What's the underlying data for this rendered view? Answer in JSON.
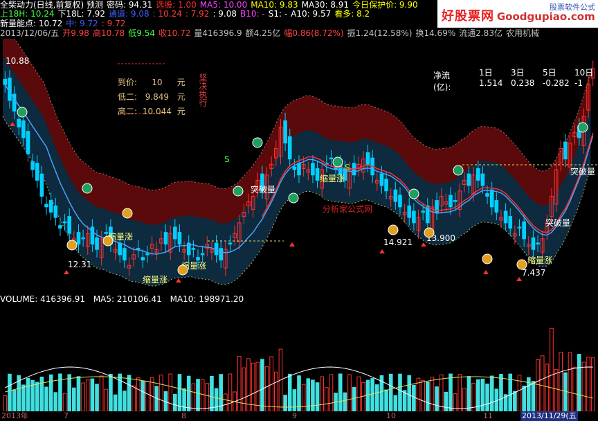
{
  "header": {
    "row1": [
      {
        "text": "全柴动力(日线,前复权) 预测",
        "color": "#ffffff"
      },
      {
        "text": "密码: 94.31",
        "color": "#ffffff"
      },
      {
        "text": "选股: 1.00",
        "color": "#ff3030"
      },
      {
        "text": "MA5: 10.00",
        "color": "#ff40ff"
      },
      {
        "text": "MA10: 9.83",
        "color": "#ffff00"
      },
      {
        "text": "MA30: 8.91",
        "color": "#ffffff"
      },
      {
        "text": "今日保护价: 9.90",
        "color": "#ffff00"
      }
    ],
    "row2": [
      {
        "text": "上18H: 10.24",
        "color": "#40ff40"
      },
      {
        "text": "下18L: 7.92",
        "color": "#ffffff"
      },
      {
        "text": "通道: 9.08",
        "color": "#4060ff"
      },
      {
        "text": ": 10.24",
        "color": "#ff4040"
      },
      {
        "text": ": 7.92",
        "color": "#ff4040"
      },
      {
        "text": ": 9.08",
        "color": "#ffffff"
      },
      {
        "text": "B10: -",
        "color": "#ff40ff"
      },
      {
        "text": "S1: -",
        "color": "#ffffff"
      },
      {
        "text": "A10: 9.57",
        "color": "#ffffff"
      },
      {
        "text": "看多: 8.2",
        "color": "#ffff00"
      }
    ],
    "row3": [
      {
        "text": "新量能点: 10.72",
        "color": "#ffffff"
      },
      {
        "text": "中: 9.72",
        "color": "#4060ff"
      },
      {
        "text": ": 9.72",
        "color": "#ff4040"
      }
    ],
    "row4": [
      {
        "text": "2013/12/06/五",
        "color": "#c0c0c0"
      },
      {
        "text": "开9.98",
        "color": "#ff4040"
      },
      {
        "text": "高10.78",
        "color": "#ff4040"
      },
      {
        "text": "低9.54",
        "color": "#40ff40"
      },
      {
        "text": "收10.72",
        "color": "#ff4040"
      },
      {
        "text": "量416396.9",
        "color": "#c0c0c0"
      },
      {
        "text": "额4.25亿",
        "color": "#c0c0c0"
      },
      {
        "text": "幅0.86(8.72%)",
        "color": "#ff4040"
      },
      {
        "text": "振1.24(12.58%)",
        "color": "#c0c0c0"
      },
      {
        "text": "换14.69%",
        "color": "#c0c0c0"
      },
      {
        "text": "流通2.83亿",
        "color": "#c0c0c0"
      },
      {
        "text": "农用机械",
        "color": "#c0c0c0"
      }
    ]
  },
  "watermark": {
    "brand": "好股票网",
    "site": "Goodgupiao.com",
    "note": "股票软件公式"
  },
  "panel": {
    "row1_label": "到价:",
    "row1_value": "10",
    "row1_unit": "元",
    "row2_label": "低二:",
    "row2_value": "9.849",
    "row2_unit": "元",
    "row3_label": "高二:",
    "row3_value": "10.044",
    "row3_unit": "元",
    "vertical": "坚决执行"
  },
  "net_flow": {
    "title": "净流(亿):",
    "periods": [
      "1日",
      "3日",
      "5日",
      "10日"
    ],
    "values": [
      "1.514",
      "0.238",
      "-0.282",
      "-1"
    ]
  },
  "annotations": {
    "peak_price": "10.88",
    "low_price_1": "12.31",
    "low_price_2": "14.921",
    "low_price_3": "13.900",
    "low_price_4": "7.437",
    "shrink_rise": "缩量涨",
    "breakout": "突破量",
    "analysis": "分析家公式网",
    "s_signal": "S"
  },
  "volume": {
    "label": "VOLUME: 416396.91",
    "ma5": "MA5: 210106.41",
    "ma10": "MA10: 198971.20"
  },
  "dates": [
    "2013年",
    "7",
    "8",
    "9",
    "10",
    "11",
    "2013/11/29(五"
  ],
  "colors": {
    "up": "#ff3030",
    "down": "#00d0ff",
    "band": "#5a0a0a",
    "channel": "#0e2a3e",
    "ma_line": "#4aa0ff"
  },
  "chart_data": {
    "type": "candlestick",
    "title": "全柴动力(日线,前复权)",
    "close": [
      10.4,
      10.1,
      9.9,
      9.6,
      9.4,
      9.1,
      8.8,
      8.6,
      8.3,
      8.1,
      8.0,
      7.9,
      7.7,
      7.8,
      7.6,
      7.5,
      7.4,
      7.5,
      7.6,
      7.4,
      7.3,
      7.5,
      7.6,
      7.4,
      7.3,
      7.2,
      7.1,
      7.0,
      7.2,
      7.3,
      7.1,
      7.2,
      7.4,
      7.3,
      7.5,
      7.4,
      7.6,
      7.5,
      7.4,
      7.3,
      7.2,
      7.3,
      7.1,
      7.2,
      7.4,
      7.3,
      7.2,
      7.1,
      7.3,
      7.4,
      7.6,
      7.8,
      8.0,
      8.2,
      8.3,
      8.6,
      8.4,
      8.7,
      8.9,
      9.2,
      9.6,
      9.3,
      9.0,
      8.8,
      8.7,
      8.9,
      8.8,
      8.7,
      8.6,
      8.8,
      8.9,
      9.0,
      8.8,
      8.7,
      8.6,
      8.8,
      8.7,
      8.9,
      9.0,
      8.9,
      8.7,
      8.6,
      8.5,
      8.4,
      8.3,
      8.2,
      8.1,
      8.0,
      7.9,
      7.8,
      7.9,
      8.0,
      7.8,
      8.1,
      8.0,
      8.3,
      8.2,
      8.1,
      8.2,
      8.4,
      8.6,
      8.5,
      8.7,
      8.6,
      8.5,
      8.3,
      8.1,
      8.0,
      7.9,
      7.8,
      7.7,
      7.6,
      7.7,
      7.5,
      7.4,
      7.3,
      7.4,
      7.5,
      7.8,
      8.3,
      8.8,
      9.2,
      9.0,
      9.3,
      9.5,
      9.4,
      9.8,
      10.4,
      10.7
    ],
    "volume_scale": "relative"
  }
}
